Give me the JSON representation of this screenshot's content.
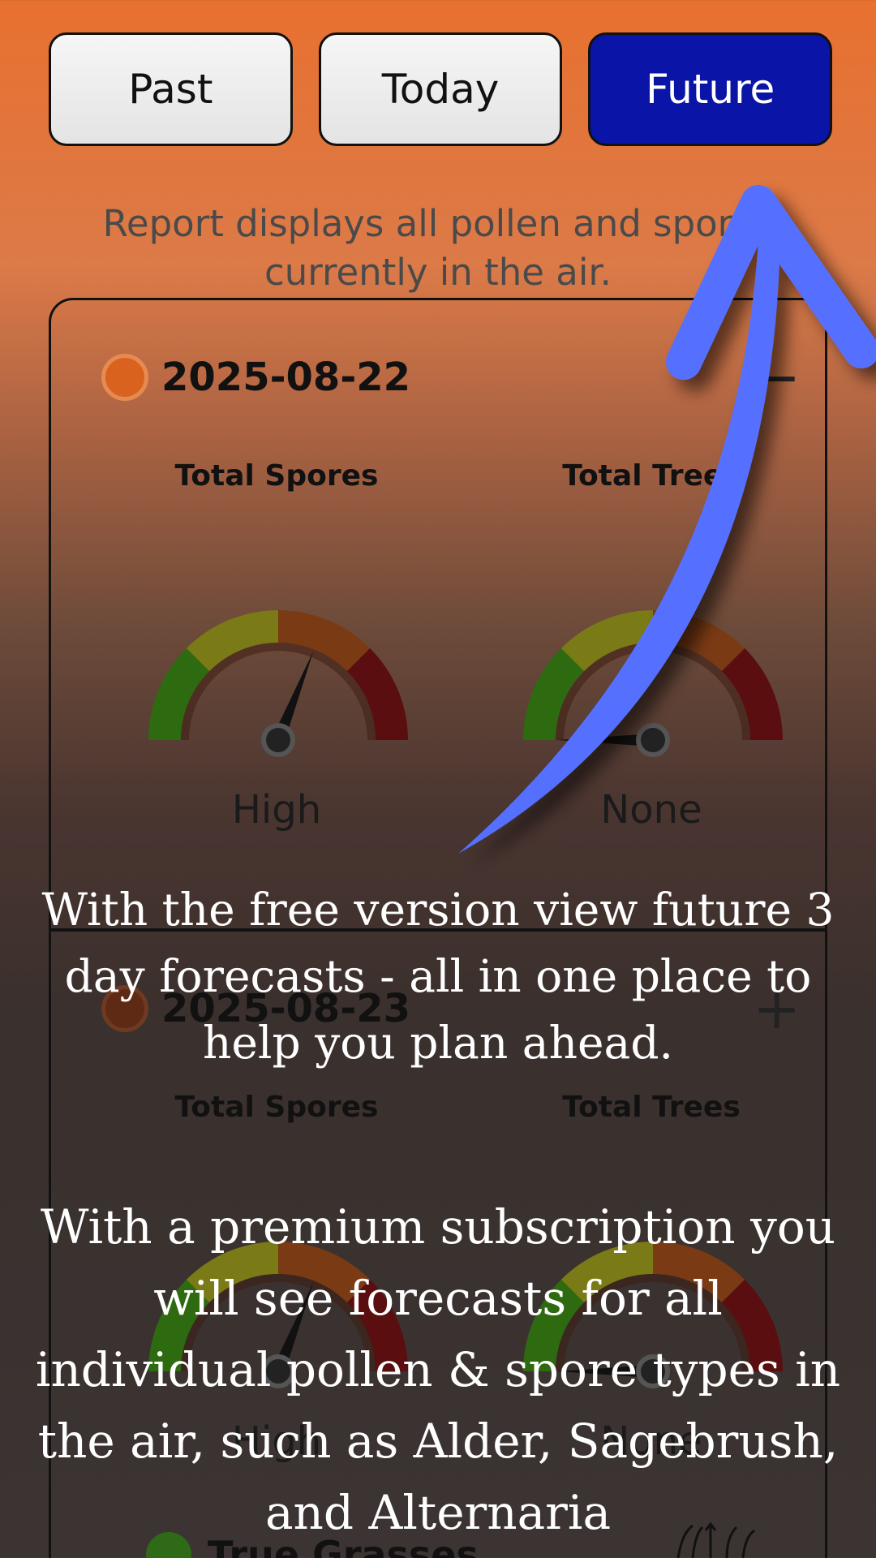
{
  "tabs": [
    {
      "label": "Past",
      "active": false
    },
    {
      "label": "Today",
      "active": false
    },
    {
      "label": "Future",
      "active": true
    }
  ],
  "subtitle": "Report displays all pollen and spores currently in the air.",
  "cards": [
    {
      "date": "2025-08-22",
      "toggle": "−",
      "metrics": [
        {
          "label": "Total Spores",
          "value": "High",
          "level": 0.62
        },
        {
          "label": "Total Trees",
          "value": "None",
          "level": 0.0
        }
      ]
    },
    {
      "date": "2025-08-23",
      "toggle": "+",
      "metrics": [
        {
          "label": "Total Spores",
          "value": "High",
          "level": 0.62
        },
        {
          "label": "Total Trees",
          "value": "None",
          "level": 0.0
        }
      ]
    }
  ],
  "next_item": {
    "label": "True Grasses"
  },
  "overlay": {
    "free_text": "With the free version view  future 3 day forecasts - all in one place to help you plan ahead.",
    "premium_text": "With a premium subscription you will see forecasts for all individual pollen & spore types in the air, such as Alder, Sagebrush, and Alternaria"
  },
  "colors": {
    "active_tab": "#0a14a6",
    "arrow": "#5570ff",
    "gauge_green": "#2e6a10",
    "gauge_yellow": "#7a7a16",
    "gauge_orange": "#7a3a14",
    "gauge_red": "#5a0e10"
  }
}
